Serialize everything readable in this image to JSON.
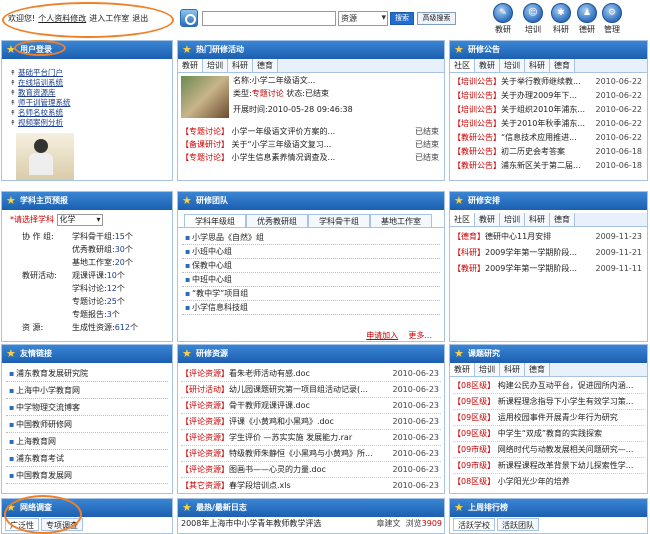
{
  "top": {
    "welcome": "欢迎您!",
    "profile": "个人资料修改",
    "enter": "进入工作室",
    "logout": "退出"
  },
  "search": {
    "select": "资源",
    "btn": "搜索",
    "adv": "高级搜索"
  },
  "nav": [
    {
      "label": "教研",
      "g": "✎"
    },
    {
      "label": "培训",
      "g": "☺"
    },
    {
      "label": "科研",
      "g": "✱"
    },
    {
      "label": "德研",
      "g": "♟"
    },
    {
      "label": "管理",
      "g": "⚙"
    }
  ],
  "userpanel": {
    "title": "用户登录",
    "links": [
      "基础平台门户",
      "在线培训系统",
      "教育资源库",
      "师干训管理系统",
      "名师名校系统",
      "视频案例分析"
    ]
  },
  "hot": {
    "title": "热门研修活动",
    "tabs": [
      "教研",
      "培训",
      "科研",
      "德育"
    ],
    "feature": {
      "name_label": "名称:",
      "name": "小学二年级语文...",
      "type_label": "类型:",
      "type": "专题讨论",
      "status_label": "状态:",
      "status": "已结束",
      "time_label": "开展时间:",
      "time": "2010-05-28 09:46:38"
    },
    "rows": [
      {
        "tag": "【专题讨论】",
        "text": "小学一年级语文评价方案的...",
        "status": "已结束"
      },
      {
        "tag": "【备课研讨】",
        "text": "关于“小学三年级语文复习...",
        "status": "已结束"
      },
      {
        "tag": "【专题讨论】",
        "text": "小学生信息素养情况调查及...",
        "status": "已结束"
      }
    ]
  },
  "notice": {
    "title": "研修公告",
    "tabs": [
      "社区",
      "教研",
      "培训",
      "科研",
      "德育"
    ],
    "rows": [
      {
        "tag": "【培训公告】",
        "text": "关于举行教师继续教...",
        "date": "2010-06-22"
      },
      {
        "tag": "【培训公告】",
        "text": "关于办理2009年下...",
        "date": "2010-06-22"
      },
      {
        "tag": "【培训公告】",
        "text": "关于组织2010年浦东...",
        "date": "2010-06-22"
      },
      {
        "tag": "【培训公告】",
        "text": "关于2010年秋季浦东...",
        "date": "2010-06-22"
      },
      {
        "tag": "【教研公告】",
        "text": "“信息技术应用推进...",
        "date": "2010-06-22"
      },
      {
        "tag": "【教研公告】",
        "text": "初二历史会考答案",
        "date": "2010-06-18"
      },
      {
        "tag": "【教研公告】",
        "text": "浦东新区关于第二届...",
        "date": "2010-06-18"
      }
    ]
  },
  "stats": {
    "title": "学科主页预报",
    "sel_label": "*请选择学科",
    "sel": "化学",
    "rows": [
      {
        "k": "协 作 组:",
        "n": "学科骨干组:",
        "v": "15",
        "u": "个"
      },
      {
        "k": "",
        "n": "优秀教研组:",
        "v": "30",
        "u": "个"
      },
      {
        "k": "",
        "n": "基地工作室:",
        "v": "20",
        "u": "个"
      },
      {
        "k": "教研活动:",
        "n": "观课评课:",
        "v": "10",
        "u": "个"
      },
      {
        "k": "",
        "n": "学科讨论:",
        "v": "12",
        "u": "个"
      },
      {
        "k": "",
        "n": "专题讨论:",
        "v": "25",
        "u": "个"
      },
      {
        "k": "",
        "n": "专题报告:",
        "v": "3",
        "u": "个"
      },
      {
        "k": "资    源:",
        "n": "生成性资源:",
        "v": "612",
        "u": "个"
      }
    ]
  },
  "team": {
    "title": "研修团队",
    "tabs": [
      "学科年级组",
      "优秀教研组",
      "学科骨干组",
      "基地工作室"
    ],
    "groups": [
      "小学思品《自然》组",
      "小班中心组",
      "保教中心组",
      "中班中心组",
      "“教中学”项目组",
      "小学信息科技组"
    ],
    "apply": "申请加入",
    "more": "更多..."
  },
  "plan": {
    "title": "研修安排",
    "tabs": [
      "社区",
      "教研",
      "培训",
      "科研",
      "德育"
    ],
    "rows": [
      {
        "tag": "【德育】",
        "text": "德研中心11月安排",
        "date": "2009-11-23"
      },
      {
        "tag": "【科研】",
        "text": "2009学年第一学期阶段...",
        "date": "2009-11-21"
      },
      {
        "tag": "【教研】",
        "text": "2009学年第一学期阶段...",
        "date": "2009-11-11"
      }
    ]
  },
  "links": {
    "title": "友情链接",
    "items": [
      "浦东教育发展研究院",
      "上海中小学教育网",
      "中学物理交流博客",
      "中国教师研修网",
      "上海教育网",
      "浦东教育考试",
      "中国教育发展网"
    ]
  },
  "resources": {
    "title": "研修资源",
    "rows": [
      {
        "tag": "【评论资源】",
        "text": "看朱老师活动有感.doc",
        "date": "2010-06-23"
      },
      {
        "tag": "【研讨活动】",
        "text": "幼儿园课题研究第一项目组活动记录(...",
        "date": "2010-06-23"
      },
      {
        "tag": "【评论资源】",
        "text": "骨干教师观课评课.doc",
        "date": "2010-06-23"
      },
      {
        "tag": "【评论资源】",
        "text": "评课《小黄鸡和小黑鸡》.doc",
        "date": "2010-06-23"
      },
      {
        "tag": "【评论资源】",
        "text": "学生评价 —苏实实施 发展能力.rar",
        "date": "2010-06-23"
      },
      {
        "tag": "【评论资源】",
        "text": "特级教师朱静恒《小黑鸡与小黄鸡》所...",
        "date": "2010-06-23"
      },
      {
        "tag": "【评论资源】",
        "text": "图画书——心灵的力量.doc",
        "date": "2010-06-23"
      },
      {
        "tag": "【其它资源】",
        "text": "春学段培训点.xls",
        "date": "2010-06-23"
      }
    ]
  },
  "research": {
    "title": "课题研究",
    "tabs": [
      "教研",
      "培训",
      "科研",
      "德育"
    ],
    "rows": [
      {
        "tag": "【08区级】",
        "text": "构建公民办互动平台，促进园所内涵..."
      },
      {
        "tag": "【09区级】",
        "text": "新课程理念指导下小学生有效学习策..."
      },
      {
        "tag": "【09区级】",
        "text": "运用校园事件开展青少年行为研究"
      },
      {
        "tag": "【09区级】",
        "text": "中学生“双成”教育的实践探索"
      },
      {
        "tag": "【09市级】",
        "text": "网络时代与动教发展相关问题研究—..."
      },
      {
        "tag": "【09市级】",
        "text": "新课程课程改革背景下幼儿探索性学..."
      },
      {
        "tag": "【08区级】",
        "text": "小学阳光少年的培养"
      }
    ]
  },
  "survey": {
    "title": "网络调查",
    "tabs": [
      "广泛性",
      "专项调查"
    ]
  },
  "blog": {
    "title": "最热/最新日志",
    "row": {
      "text": "2008年上海市中小学青年教师教学评选",
      "author": "章建文",
      "views_label": "浏览",
      "views": "3909"
    }
  },
  "rank": {
    "title": "上周排行榜",
    "tabs": [
      "活跃学校",
      "活跃团队"
    ]
  }
}
